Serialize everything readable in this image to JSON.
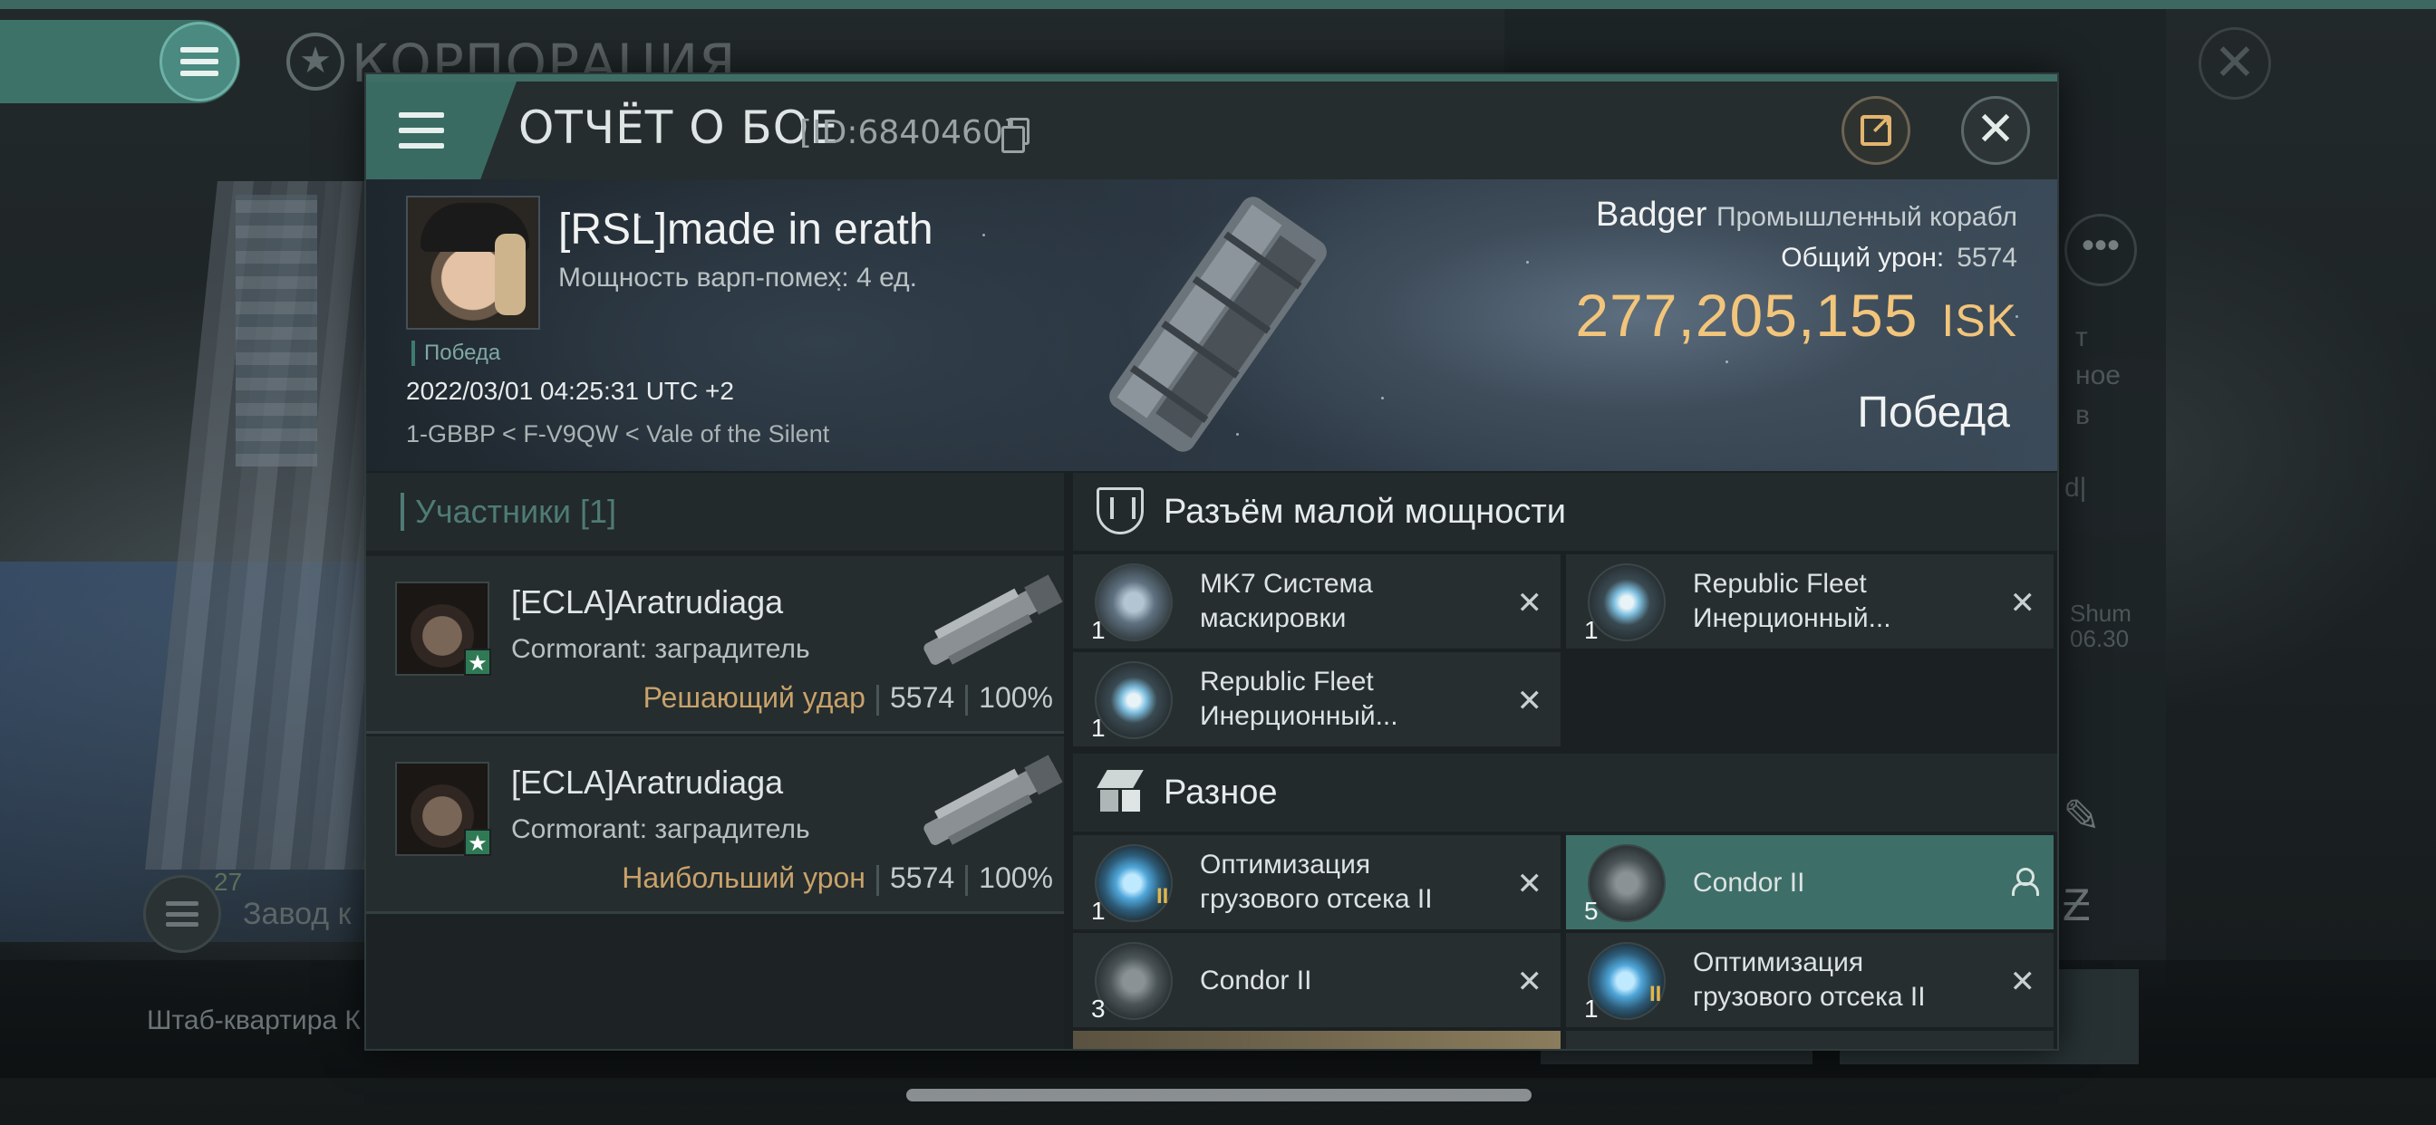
{
  "background": {
    "corporation_title": "КОРПОРАЦИЯ",
    "factory_count": "27",
    "factory_label": "Завод к",
    "hq_label": "Штаб-квартира К",
    "side_text_1": "т",
    "side_text_2": "ное",
    "side_text_3": "в",
    "side_text_4": "d|",
    "side_text_5": "Shum",
    "side_text_6": "06.30"
  },
  "dialog": {
    "title": "ОТЧЁТ О БОЕ",
    "report_id": "[ID:6840460]",
    "victim": {
      "name": "[RSL]made in erath",
      "warp_disruption": "Мощность варп-помех: 4 ед.",
      "badge": "Победа",
      "datetime": "2022/03/01 04:25:31 UTC +2",
      "location": "1-GBBP < F-V9QW < Vale of the Silent",
      "ship_name": "Badger",
      "ship_type": "Промышленный корабл",
      "total_damage_label": "Общий урон:",
      "total_damage_value": "5574",
      "isk_value": "277,205,155",
      "isk_unit": "ISK",
      "outcome": "Победа"
    },
    "participants": {
      "header": "Участники [1]",
      "rows": [
        {
          "name": "[ECLA]Aratrudiaga",
          "ship": "Cormorant: заградитель",
          "role": "Решающий удар",
          "damage": "5574",
          "percent": "100%"
        },
        {
          "name": "[ECLA]Aratrudiaga",
          "ship": "Cormorant: заградитель",
          "role": "Наибольший урон",
          "damage": "5574",
          "percent": "100%"
        }
      ]
    },
    "sections": [
      {
        "title": "Разъём малой мощности",
        "items": [
          {
            "qty": "1",
            "name_line1": "MK7 Система",
            "name_line2": "маскировки"
          },
          {
            "qty": "1",
            "name_line1": "Republic Fleet",
            "name_line2": "Инерционный..."
          },
          {
            "qty": "1",
            "name_line1": "Republic Fleet",
            "name_line2": "Инерционный..."
          }
        ]
      },
      {
        "title": "Разное",
        "items": [
          {
            "qty": "1",
            "tier": "II",
            "name_line1": "Оптимизация",
            "name_line2": "грузового отсека II"
          },
          {
            "qty": "5",
            "name_line1": "Condor II",
            "name_line2": ""
          },
          {
            "qty": "3",
            "name_line1": "Condor II",
            "name_line2": ""
          },
          {
            "qty": "1",
            "tier": "II",
            "name_line1": "Оптимизация",
            "name_line2": "грузового отсека II"
          }
        ]
      }
    ]
  }
}
